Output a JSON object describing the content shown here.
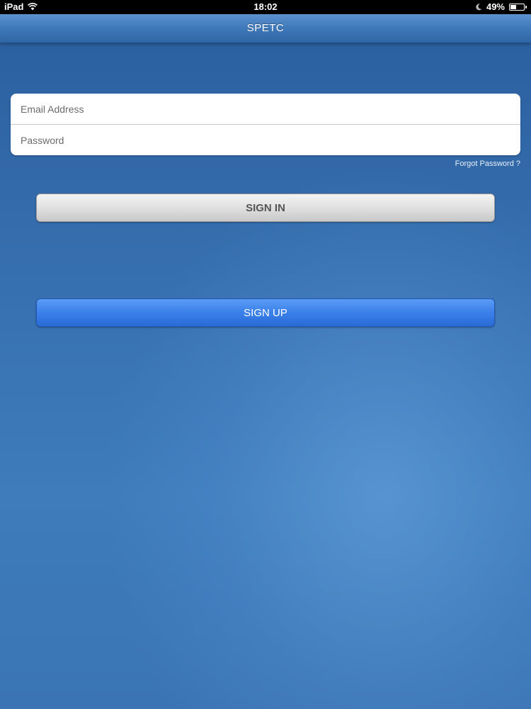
{
  "status_bar": {
    "device": "iPad",
    "time": "18:02",
    "battery": "49%",
    "battery_level": 0.49,
    "icons": [
      "wifi-icon",
      "moon-icon",
      "battery-icon"
    ]
  },
  "nav": {
    "title": "SPETC"
  },
  "login_form": {
    "email_placeholder": "Email Address",
    "email_value": "",
    "password_placeholder": "Password",
    "password_value": "",
    "forgot_password": "Forgot Password ?"
  },
  "buttons": {
    "sign_in": "SIGN IN",
    "sign_up": "SIGN UP"
  },
  "colors": {
    "nav_bar": "#3f78b9",
    "background": "#3770b0",
    "sign_up_button": "#3b80ea",
    "sign_in_button": "#e0e0e0"
  }
}
